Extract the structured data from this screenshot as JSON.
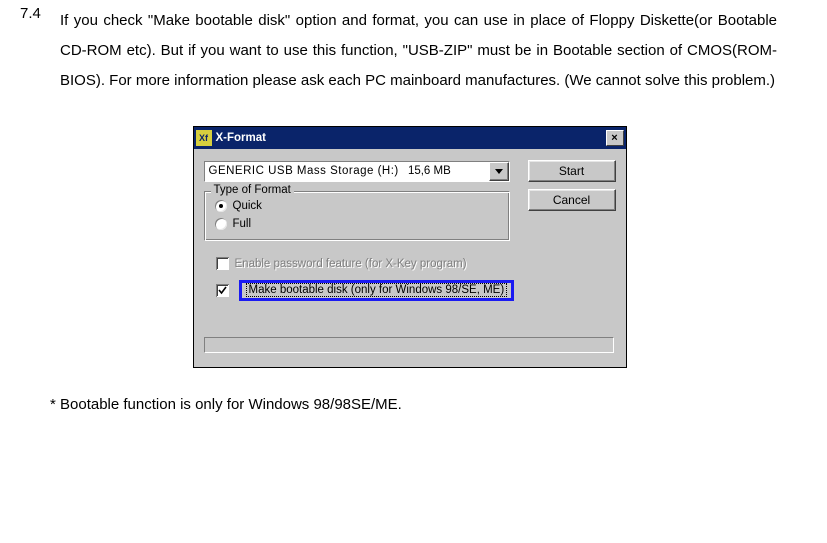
{
  "section": {
    "number": "7.4",
    "body": "If you check \"Make bootable disk\" option and format, you can use in place of Floppy Diskette(or Bootable CD-ROM etc). But if you want to use this function, \"USB-ZIP\" must be in Bootable section of CMOS(ROM-BIOS). For more information please ask each PC mainboard manufactures. (We cannot solve this problem.)",
    "footnote": "* Bootable function is only for Windows 98/98SE/ME."
  },
  "dialog": {
    "title": "X-Format",
    "app_icon_text": "Xf",
    "close_glyph": "×",
    "combo": {
      "drive_text": "GENERIC USB Mass Storage (H:)",
      "size_text": "15,6 MB"
    },
    "buttons": {
      "start": "Start",
      "cancel": "Cancel"
    },
    "group": {
      "legend": "Type of Format",
      "quick": "Quick",
      "full": "Full",
      "selected": "quick"
    },
    "checks": {
      "password": {
        "checked": false,
        "label": "Enable password feature (for X-Key program)",
        "disabled": true
      },
      "bootable": {
        "checked": true,
        "label": "Make bootable disk (only for Windows 98/SE, ME)",
        "highlighted": true
      }
    }
  }
}
